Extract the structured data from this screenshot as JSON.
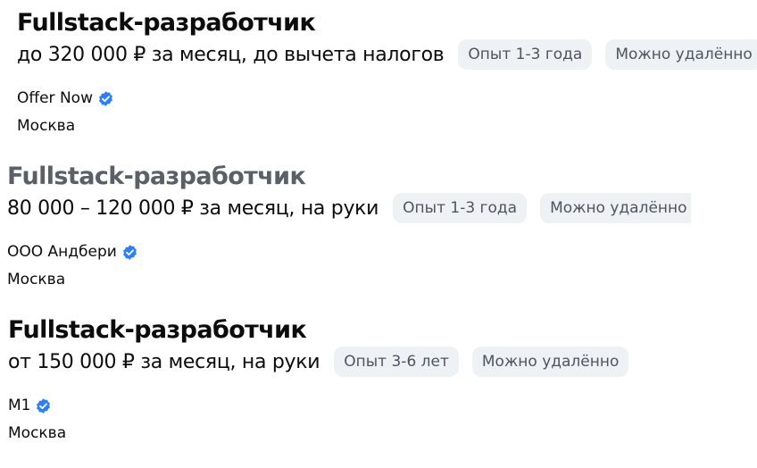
{
  "vacancies": [
    {
      "title": "Fullstack-разработчик",
      "salary": "до 320 000 ₽ за месяц, до вычета налогов",
      "chips": [
        "Опыт 1-3 года",
        "Можно удалённо"
      ],
      "company": "Offer Now",
      "city": "Москва"
    },
    {
      "title": "Fullstack-разработчик",
      "salary": "80 000 – 120 000 ₽ за месяц, на руки",
      "chips": [
        "Опыт 1-3 года",
        "Можно удалённо"
      ],
      "company": "ООО Андбери",
      "city": "Москва"
    },
    {
      "title": "Fullstack-разработчик",
      "salary": "от 150 000 ₽ за месяц, на руки",
      "chips": [
        "Опыт 3-6 лет",
        "Можно удалённо"
      ],
      "company": "M1",
      "city": "Москва"
    }
  ],
  "icons": {
    "verified": "verified-check-icon"
  },
  "colors": {
    "verified": "#2b7fff",
    "chip_bg": "#eff2f5",
    "chip_text": "#4c5562",
    "muted_title": "#5b6066"
  }
}
